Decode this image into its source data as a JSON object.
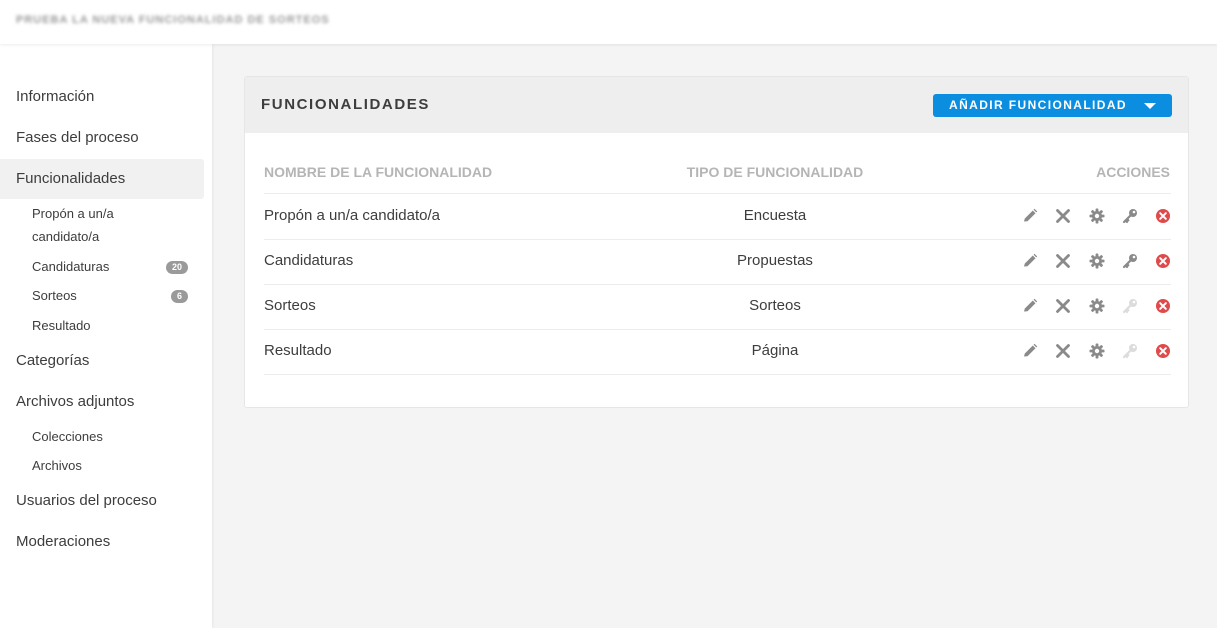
{
  "header": {
    "process_title": "PRUEBA LA NUEVA FUNCIONALIDAD DE SORTEOS"
  },
  "sidebar": {
    "items": [
      {
        "label": "Información"
      },
      {
        "label": "Fases del proceso"
      },
      {
        "label": "Funcionalidades",
        "active": true
      },
      {
        "label": "Categorías"
      },
      {
        "label": "Archivos adjuntos"
      },
      {
        "label": "Usuarios del proceso"
      },
      {
        "label": "Moderaciones"
      }
    ],
    "funcionalidades_sub": [
      {
        "label_line1": "Propón a un/a",
        "label_line2": "candidato/a"
      },
      {
        "label": "Candidaturas",
        "badge": "20"
      },
      {
        "label": "Sorteos",
        "badge": "6"
      },
      {
        "label": "Resultado"
      }
    ],
    "adjuntos_sub": [
      {
        "label": "Colecciones"
      },
      {
        "label": "Archivos"
      }
    ]
  },
  "card": {
    "title": "FUNCIONALIDADES",
    "add_button_label": "AÑADIR FUNCIONALIDAD",
    "columns": [
      "NOMBRE DE LA FUNCIONALIDAD",
      "TIPO DE FUNCIONALIDAD",
      "ACCIONES"
    ],
    "rows": [
      {
        "name": "Propón a un/a candidato/a",
        "type": "Encuesta",
        "permissions_enabled": true
      },
      {
        "name": "Candidaturas",
        "type": "Propuestas",
        "permissions_enabled": true
      },
      {
        "name": "Sorteos",
        "type": "Sorteos",
        "permissions_enabled": false
      },
      {
        "name": "Resultado",
        "type": "Página",
        "permissions_enabled": false
      }
    ],
    "action_icons": [
      "pencil-icon",
      "x-icon",
      "gear-icon",
      "key-icon",
      "delete-circle-icon"
    ]
  },
  "colors": {
    "accent": "#0b8ee0",
    "icon_gray": "#8a8a8a",
    "icon_disabled": "#dcdcdc",
    "delete_red": "#e04a4a"
  }
}
